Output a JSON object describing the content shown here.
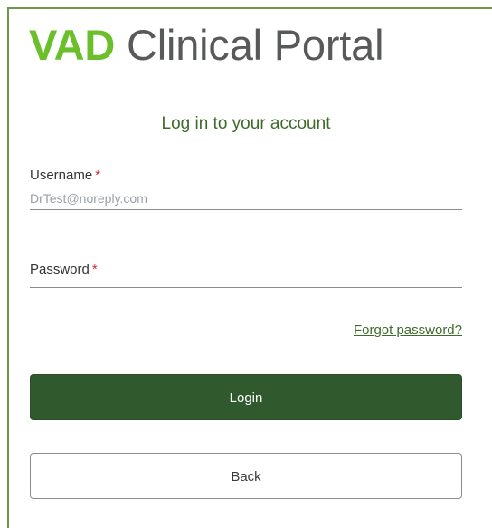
{
  "brand": {
    "accent": "VAD",
    "rest": "Clinical Portal",
    "accent_color": "#6abf2a",
    "text_color": "#58595b"
  },
  "form": {
    "title": "Log in to your account",
    "username": {
      "label": "Username",
      "required_marker": "*",
      "placeholder": "DrTest@noreply.com",
      "value": ""
    },
    "password": {
      "label": "Password",
      "required_marker": "*",
      "placeholder": "",
      "value": ""
    },
    "forgot_link": "Forgot password?",
    "login_button": "Login",
    "back_button": "Back"
  },
  "colors": {
    "primary": "#305a2e",
    "border_accent": "#6a9a45",
    "required": "#d42a2a"
  }
}
